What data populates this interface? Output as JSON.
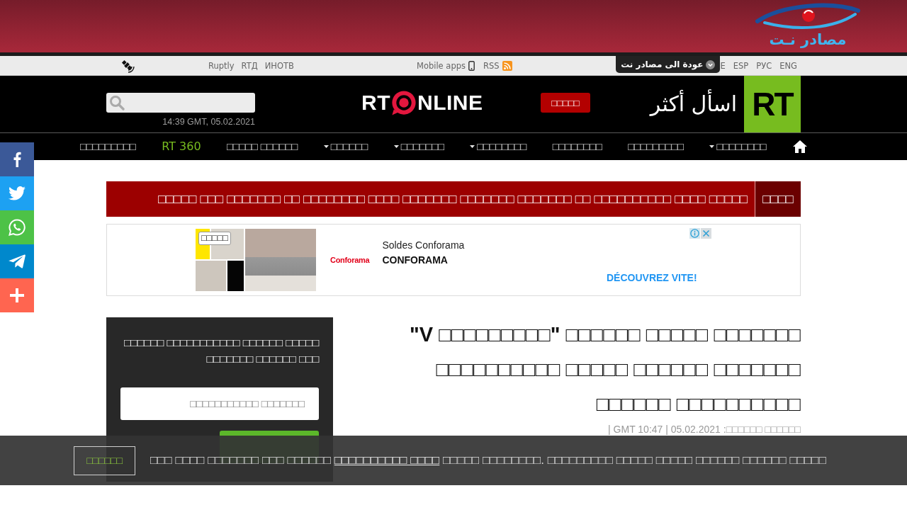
{
  "banner": {
    "logo_text": "مصادر نـت"
  },
  "top_bar": {
    "links": [
      "Ruptly",
      "RTД",
      "ИНОТВ"
    ],
    "mobile_apps": "Mobile apps",
    "rss": "RSS",
    "back_tab": "عودة الى مصادر نت",
    "languages": [
      "E",
      "ESP",
      "РУС",
      "ENG"
    ]
  },
  "header": {
    "datetime": "14:39 GMT, 05.02.2021",
    "logo": {
      "left": "RT",
      "right": "NLINE"
    },
    "button": "□□□□□",
    "tagline": "اسأل أكثر",
    "brand": "RT"
  },
  "nav": [
    {
      "label": "□□□□□□□□□",
      "kind": "text",
      "dropdown": false
    },
    {
      "label": "RT 360",
      "kind": "brand",
      "dropdown": false
    },
    {
      "label": "□□□□□ □□□□□□",
      "kind": "text",
      "dropdown": false
    },
    {
      "label": "□□□□□□",
      "kind": "text",
      "dropdown": true
    },
    {
      "label": "□□□□□□□",
      "kind": "text",
      "dropdown": true
    },
    {
      "label": "□□□□□□□□",
      "kind": "text",
      "dropdown": true
    },
    {
      "label": "□□□□□□□□",
      "kind": "text",
      "dropdown": false
    },
    {
      "label": "□□□□□□□□□",
      "kind": "text",
      "dropdown": false
    },
    {
      "label": "□□□□□□□□",
      "kind": "text",
      "dropdown": true
    }
  ],
  "breaking_news": {
    "headline": "□□□□□ □□□ □□□□□□□ □□ □□□□□□□□ □□□□ □□□□□□□ □□□□□□□ □□□□□□□ □□ □□□□□□□□□□ □□□□ □□□□□",
    "label": "□□□□"
  },
  "ad": {
    "image_tag": "□□□□□",
    "logo": "Conforama",
    "title": "Soldes Conforama",
    "advertiser": "CONFORAMA",
    "cta": "DÉCOUVREZ VITE!"
  },
  "article": {
    "headline": "\"V □□□□□□□□□\" □□□□□□ □□□□□ □□□□□□□ □□□□□□□□□□ □□□□□ □□□□□□ □□□□□□□ □□□□□□ □□□□□□□□□□",
    "meta": "| GMT 10:47 | 05.02.2021 :□□□□□□ □□□□□□"
  },
  "newsletter": {
    "heading": "□□□□□□ □□□□□□□□□□□ □□□□□□ □□□□□ □□□□□□□ □□□□□□ □□□",
    "email_placeholder": "□□□□□□□□□□□ □□□□□□□"
  },
  "cookie_notice": {
    "button": "□□□□□□",
    "text_start": "□□□ □□□□ □□□□□□□ □□□ □□□□□□ ",
    "link_text": "□□□□□□□□□□ □□□□",
    "text_end": " □□□□□ □□□□□□□□. □□□□□□□□□ □□□□□ □□□□□ □□□□□□ □□□□□□ □□□□□"
  }
}
